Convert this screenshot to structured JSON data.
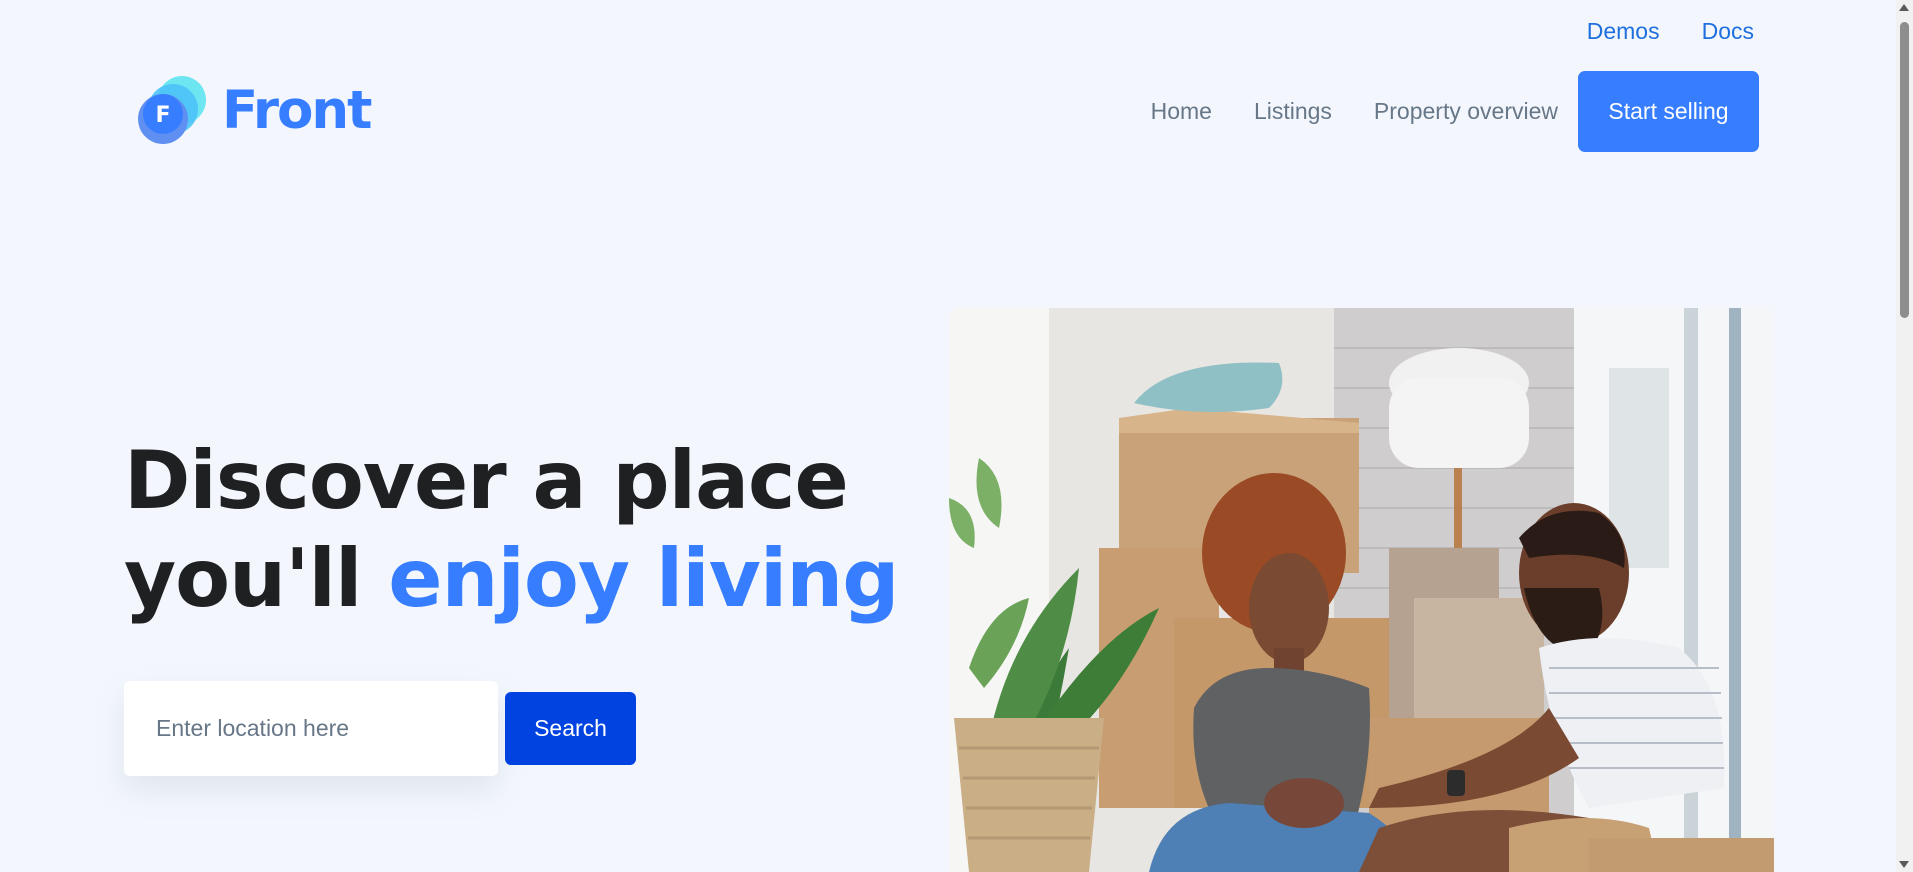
{
  "topbar": {
    "demos": "Demos",
    "docs": "Docs"
  },
  "logo": {
    "text": "Front",
    "mark_letter": "F"
  },
  "nav": {
    "items": [
      {
        "label": "Home"
      },
      {
        "label": "Listings"
      },
      {
        "label": "Property overview"
      }
    ],
    "cta": "Start selling"
  },
  "hero": {
    "title_line1": "Discover a place",
    "title_line2_plain": "you'll ",
    "title_line2_accent": "enjoy living",
    "search_placeholder": "Enter location here",
    "search_button": "Search",
    "image_icon": "couple-moving-boxes-photo"
  },
  "colors": {
    "primary": "#377dff",
    "search_button": "#0043e0",
    "heading": "#1e2022",
    "nav_text": "#677788",
    "background": "#f3f7fd"
  }
}
